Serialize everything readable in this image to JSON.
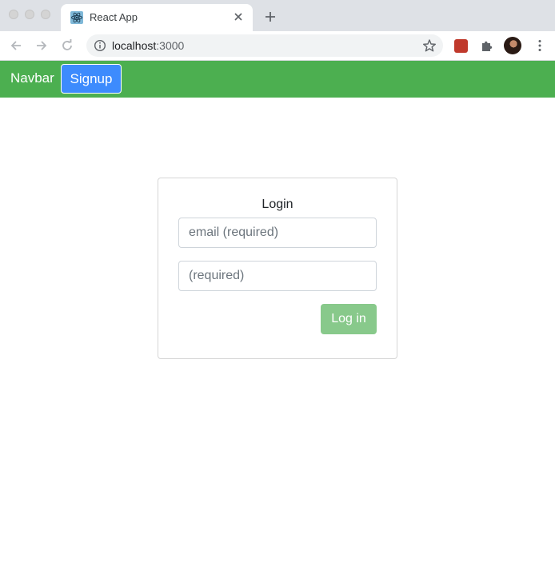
{
  "browser": {
    "tab_title": "React App",
    "url_host": "localhost",
    "url_port": ":3000"
  },
  "navbar": {
    "brand": "Navbar",
    "signup_label": "Signup",
    "colors": {
      "background": "#4caf50",
      "signup_button": "#3d8bfd"
    }
  },
  "login": {
    "title": "Login",
    "email_placeholder": "email (required)",
    "email_value": "",
    "password_placeholder": "(required)",
    "password_value": "",
    "submit_label": "Log in",
    "colors": {
      "submit_button": "#88c98b"
    }
  },
  "icons": [
    "react-favicon-icon",
    "close-icon",
    "plus-icon",
    "back-arrow-icon",
    "forward-arrow-icon",
    "reload-icon",
    "info-icon",
    "star-icon",
    "extension-icon",
    "puzzle-icon",
    "profile-avatar",
    "more-vertical-icon"
  ]
}
